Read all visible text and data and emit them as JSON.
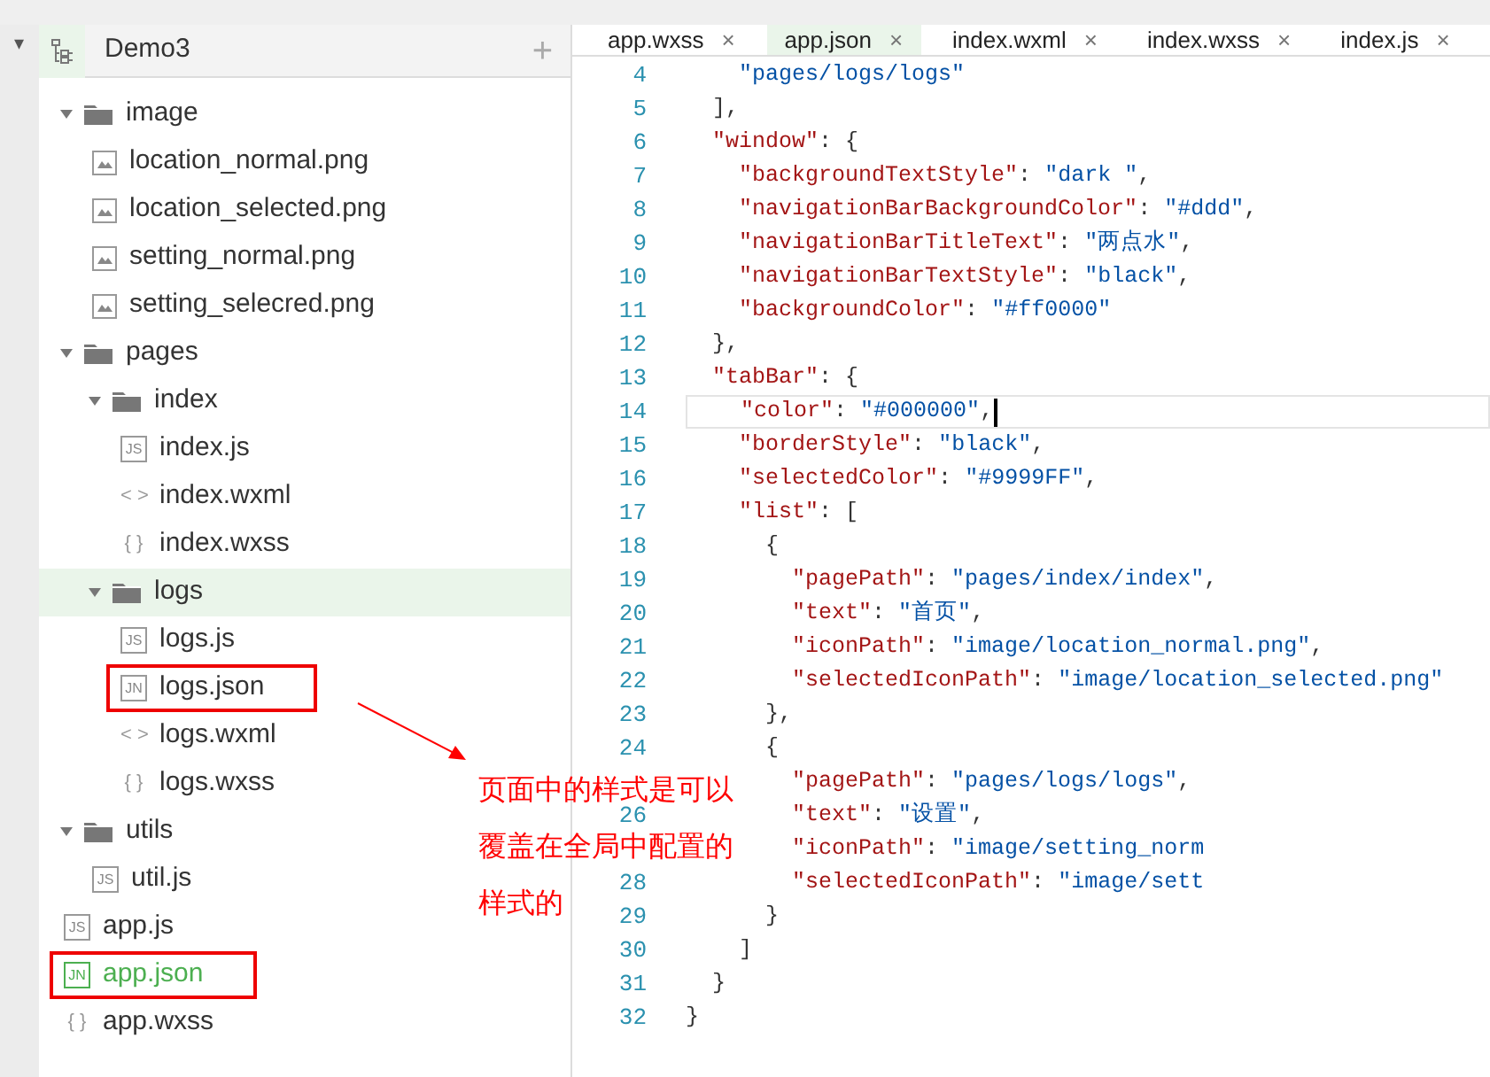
{
  "left_strip": {
    "caret": "▾"
  },
  "sidebar": {
    "project": "Demo3",
    "add": "+",
    "tree": [
      {
        "kind": "folder",
        "label": "image",
        "expanded": true,
        "selected": false,
        "children": [
          {
            "kind": "image",
            "label": "location_normal.png",
            "selected": false
          },
          {
            "kind": "image",
            "label": "location_selected.png",
            "selected": false
          },
          {
            "kind": "image",
            "label": "setting_normal.png",
            "selected": false
          },
          {
            "kind": "image",
            "label": "setting_selecred.png",
            "selected": false
          }
        ]
      },
      {
        "kind": "folder",
        "label": "pages",
        "expanded": true,
        "selected": false,
        "children": [
          {
            "kind": "folder",
            "label": "index",
            "expanded": true,
            "selected": false,
            "children": [
              {
                "kind": "badge",
                "icon": "JS",
                "label": "index.js",
                "selected": false
              },
              {
                "kind": "glyph",
                "icon": "< >",
                "label": "index.wxml",
                "selected": false
              },
              {
                "kind": "glyph",
                "icon": "{ }",
                "label": "index.wxss",
                "selected": false
              }
            ]
          },
          {
            "kind": "folder",
            "label": "logs",
            "expanded": true,
            "selected": true,
            "children": [
              {
                "kind": "badge",
                "icon": "JS",
                "label": "logs.js",
                "selected": false
              },
              {
                "kind": "badge",
                "icon": "JN",
                "label": "logs.json",
                "selected": false,
                "framed": true
              },
              {
                "kind": "glyph",
                "icon": "< >",
                "label": "logs.wxml",
                "selected": false
              },
              {
                "kind": "glyph",
                "icon": "{ }",
                "label": "logs.wxss",
                "selected": false
              }
            ]
          }
        ]
      },
      {
        "kind": "folder",
        "label": "utils",
        "expanded": true,
        "selected": false,
        "children": [
          {
            "kind": "badge",
            "icon": "JS",
            "label": "util.js",
            "selected": false
          }
        ]
      },
      {
        "kind": "badge",
        "icon": "JS",
        "label": "app.js",
        "selected": false
      },
      {
        "kind": "badge",
        "icon": "JN",
        "label": "app.json",
        "selected": false,
        "active": true,
        "framed": true
      },
      {
        "kind": "glyph",
        "icon": "{ }",
        "label": "app.wxss",
        "selected": false
      }
    ]
  },
  "tabs": [
    {
      "label": "app.wxss",
      "close": "×",
      "selected": false
    },
    {
      "label": "app.json",
      "close": "×",
      "selected": true
    },
    {
      "label": "index.wxml",
      "close": "×",
      "selected": false
    },
    {
      "label": "index.wxss",
      "close": "×",
      "selected": false
    },
    {
      "label": "index.js",
      "close": "×",
      "selected": false
    }
  ],
  "code": [
    {
      "number": "4",
      "current": false,
      "tokens": [
        {
          "kind": "string",
          "text": "    \"pages/logs/logs\""
        }
      ]
    },
    {
      "number": "5",
      "current": false,
      "tokens": [
        {
          "kind": "punct",
          "text": "  ],"
        }
      ]
    },
    {
      "number": "6",
      "current": false,
      "tokens": [
        {
          "kind": "key",
          "text": "  \"window\""
        },
        {
          "kind": "punct",
          "text": ": {"
        }
      ]
    },
    {
      "number": "7",
      "current": false,
      "tokens": [
        {
          "kind": "key",
          "text": "    \"backgroundTextStyle\""
        },
        {
          "kind": "punct",
          "text": ": "
        },
        {
          "kind": "string",
          "text": "\"dark \""
        },
        {
          "kind": "punct",
          "text": ","
        }
      ]
    },
    {
      "number": "8",
      "current": false,
      "tokens": [
        {
          "kind": "key",
          "text": "    \"navigationBarBackgroundColor\""
        },
        {
          "kind": "punct",
          "text": ": "
        },
        {
          "kind": "string",
          "text": "\"#ddd\""
        },
        {
          "kind": "punct",
          "text": ","
        }
      ]
    },
    {
      "number": "9",
      "current": false,
      "tokens": [
        {
          "kind": "key",
          "text": "    \"navigationBarTitleText\""
        },
        {
          "kind": "punct",
          "text": ": "
        },
        {
          "kind": "string",
          "text": "\"两点水\""
        },
        {
          "kind": "punct",
          "text": ","
        }
      ]
    },
    {
      "number": "10",
      "current": false,
      "tokens": [
        {
          "kind": "key",
          "text": "    \"navigationBarTextStyle\""
        },
        {
          "kind": "punct",
          "text": ": "
        },
        {
          "kind": "string",
          "text": "\"black\""
        },
        {
          "kind": "punct",
          "text": ","
        }
      ]
    },
    {
      "number": "11",
      "current": false,
      "tokens": [
        {
          "kind": "key",
          "text": "    \"backgroundColor\""
        },
        {
          "kind": "punct",
          "text": ": "
        },
        {
          "kind": "string",
          "text": "\"#ff0000\""
        }
      ]
    },
    {
      "number": "12",
      "current": false,
      "tokens": [
        {
          "kind": "punct",
          "text": "  },"
        }
      ]
    },
    {
      "number": "13",
      "current": false,
      "tokens": [
        {
          "kind": "key",
          "text": "  \"tabBar\""
        },
        {
          "kind": "punct",
          "text": ": {"
        }
      ]
    },
    {
      "number": "14",
      "current": true,
      "tokens": [
        {
          "kind": "key",
          "text": "    \"color\""
        },
        {
          "kind": "punct",
          "text": ": "
        },
        {
          "kind": "string",
          "text": "\"#000000\""
        },
        {
          "kind": "punct",
          "text": ","
        }
      ]
    },
    {
      "number": "15",
      "current": false,
      "tokens": [
        {
          "kind": "key",
          "text": "    \"borderStyle\""
        },
        {
          "kind": "punct",
          "text": ": "
        },
        {
          "kind": "string",
          "text": "\"black\""
        },
        {
          "kind": "punct",
          "text": ","
        }
      ]
    },
    {
      "number": "16",
      "current": false,
      "tokens": [
        {
          "kind": "key",
          "text": "    \"selectedColor\""
        },
        {
          "kind": "punct",
          "text": ": "
        },
        {
          "kind": "string",
          "text": "\"#9999FF\""
        },
        {
          "kind": "punct",
          "text": ","
        }
      ]
    },
    {
      "number": "17",
      "current": false,
      "tokens": [
        {
          "kind": "key",
          "text": "    \"list\""
        },
        {
          "kind": "punct",
          "text": ": ["
        }
      ]
    },
    {
      "number": "18",
      "current": false,
      "tokens": [
        {
          "kind": "punct",
          "text": "      {"
        }
      ]
    },
    {
      "number": "19",
      "current": false,
      "tokens": [
        {
          "kind": "key",
          "text": "        \"pagePath\""
        },
        {
          "kind": "punct",
          "text": ": "
        },
        {
          "kind": "string",
          "text": "\"pages/index/index\""
        },
        {
          "kind": "punct",
          "text": ","
        }
      ]
    },
    {
      "number": "20",
      "current": false,
      "tokens": [
        {
          "kind": "key",
          "text": "        \"text\""
        },
        {
          "kind": "punct",
          "text": ": "
        },
        {
          "kind": "string",
          "text": "\"首页\""
        },
        {
          "kind": "punct",
          "text": ","
        }
      ]
    },
    {
      "number": "21",
      "current": false,
      "tokens": [
        {
          "kind": "key",
          "text": "        \"iconPath\""
        },
        {
          "kind": "punct",
          "text": ": "
        },
        {
          "kind": "string",
          "text": "\"image/location_normal.png\""
        },
        {
          "kind": "punct",
          "text": ","
        }
      ]
    },
    {
      "number": "22",
      "current": false,
      "tokens": [
        {
          "kind": "key",
          "text": "        \"selectedIconPath\""
        },
        {
          "kind": "punct",
          "text": ": "
        },
        {
          "kind": "string",
          "text": "\"image/location_selected.png\""
        }
      ]
    },
    {
      "number": "23",
      "current": false,
      "tokens": [
        {
          "kind": "punct",
          "text": "      },"
        }
      ]
    },
    {
      "number": "24",
      "current": false,
      "tokens": [
        {
          "kind": "punct",
          "text": "      {"
        }
      ]
    },
    {
      "current": false,
      "tokens": [
        {
          "kind": "key",
          "text": "        \"pagePath\""
        },
        {
          "kind": "punct",
          "text": ": "
        },
        {
          "kind": "string",
          "text": "\"pages/logs/logs\""
        },
        {
          "kind": "punct",
          "text": ","
        }
      ]
    },
    {
      "number": "26",
      "current": false,
      "tokens": [
        {
          "kind": "key",
          "text": "        \"text\""
        },
        {
          "kind": "punct",
          "text": ": "
        },
        {
          "kind": "string",
          "text": "\"设置\""
        },
        {
          "kind": "punct",
          "text": ","
        }
      ]
    },
    {
      "current": false,
      "tokens": [
        {
          "kind": "key",
          "text": "        \"iconPath\""
        },
        {
          "kind": "punct",
          "text": ": "
        },
        {
          "kind": "string",
          "text": "\"image/setting_norm"
        }
      ]
    },
    {
      "number": "28",
      "current": false,
      "tokens": [
        {
          "kind": "key",
          "text": "        \"selectedIconPath\""
        },
        {
          "kind": "punct",
          "text": ": "
        },
        {
          "kind": "string",
          "text": "\"image/sett"
        }
      ]
    },
    {
      "number": "29",
      "current": false,
      "tokens": [
        {
          "kind": "punct",
          "text": "      }"
        }
      ]
    },
    {
      "number": "30",
      "current": false,
      "tokens": [
        {
          "kind": "punct",
          "text": "    ]"
        }
      ]
    },
    {
      "number": "31",
      "current": false,
      "tokens": [
        {
          "kind": "punct",
          "text": "  }"
        }
      ]
    },
    {
      "number": "32",
      "current": false,
      "tokens": [
        {
          "kind": "punct",
          "text": "}"
        }
      ]
    }
  ],
  "annotation": {
    "lines": [
      "页面中的样式是可以",
      "覆盖在全局中配置的",
      "样式的"
    ]
  }
}
